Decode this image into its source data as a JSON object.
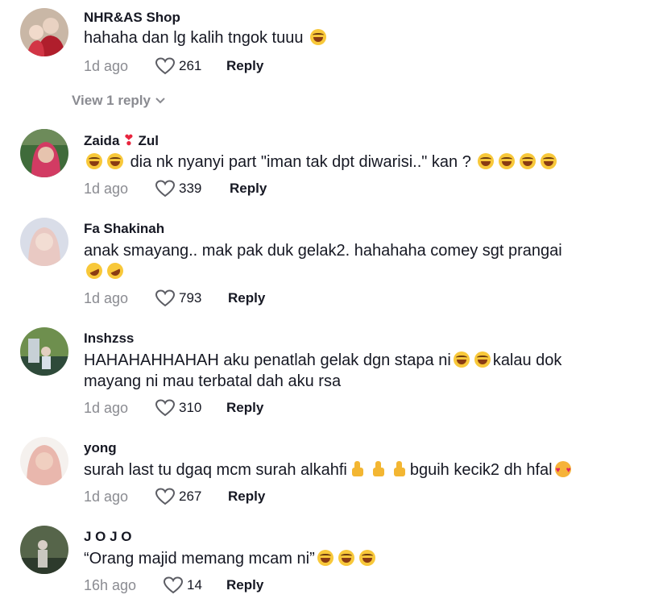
{
  "comments": [
    {
      "username": "NHR&AS Shop",
      "text": "hahaha dan lg kalih tngok tuuu",
      "time": "1d ago",
      "likes": "261",
      "reply": "Reply",
      "view_replies": "View 1 reply",
      "avatar_colors": [
        "#c9b7a6",
        "#b01e2c",
        "#e9d2c2"
      ]
    },
    {
      "username_part1": "Zaida",
      "username_part2": "Zul",
      "text": "dia nk nyanyi part \"iman tak dpt diwarisi..\" kan ?",
      "time": "1d ago",
      "likes": "339",
      "reply": "Reply",
      "avatar_colors": [
        "#3f6b3a",
        "#d23b63",
        "#e6c3ae"
      ]
    },
    {
      "username": "Fa Shakinah",
      "text_line1": "anak smayang.. mak pak duk gelak2. hahahaha comey sgt prangai",
      "time": "1d ago",
      "likes": "793",
      "reply": "Reply",
      "avatar_colors": [
        "#d9dde8",
        "#e9c9c3",
        "#f2ddd3"
      ]
    },
    {
      "username": "Inshzss",
      "text_part1": "HAHAHAHHAHAH aku penatlah gelak dgn stapa ni",
      "text_part2": "kalau dok",
      "text_line2": "mayang ni mau terbatal dah aku rsa",
      "time": "1d ago",
      "likes": "310",
      "reply": "Reply",
      "avatar_colors": [
        "#6e8f4e",
        "#c7d0d6",
        "#2e4a3a"
      ]
    },
    {
      "username": "yong",
      "text_part1": "surah last tu dgaq mcm surah alkahfi",
      "text_part2": "bguih kecik2 dh hfal",
      "time": "1d ago",
      "likes": "267",
      "reply": "Reply",
      "avatar_colors": [
        "#e9b7ad",
        "#f5f1ee",
        "#f0cfc0"
      ]
    },
    {
      "username": "J O J O",
      "text": "“Orang majid memang mcam ni”",
      "time": "16h ago",
      "likes": "14",
      "reply": "Reply",
      "avatar_colors": [
        "#56654a",
        "#2d3a2c",
        "#c9c7c0"
      ]
    }
  ]
}
